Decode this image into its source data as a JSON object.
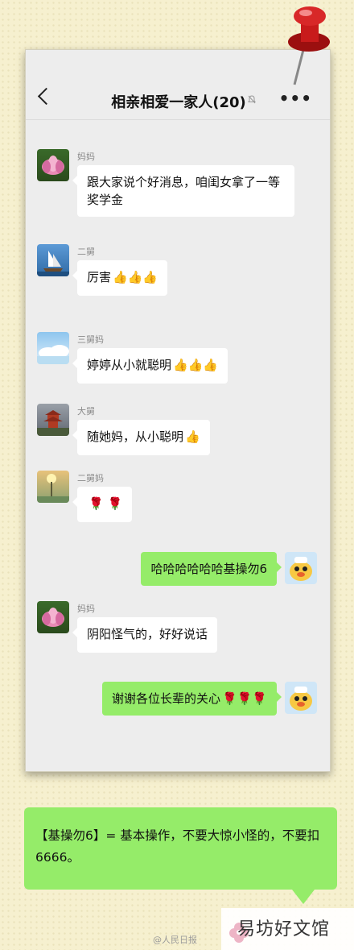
{
  "chat": {
    "title": "相亲相爱一家人(20)",
    "mute_icon": "bell-off-icon",
    "more_label": "•••"
  },
  "messages": [
    {
      "sender": "妈妈",
      "text": "跟大家说个好消息，咱闺女拿了一等奖学金",
      "emoji": ""
    },
    {
      "sender": "二舅",
      "text": "厉害",
      "emoji": "👍👍👍"
    },
    {
      "sender": "三舅妈",
      "text": "婷婷从小就聪明",
      "emoji": "👍👍👍"
    },
    {
      "sender": "大舅",
      "text": "随她妈，从小聪明",
      "emoji": "👍"
    },
    {
      "sender": "二舅妈",
      "text": "",
      "emoji": "🌹 🌹"
    },
    {
      "sender": "me",
      "text": "哈哈哈哈哈哈基操勿6",
      "emoji": ""
    },
    {
      "sender": "妈妈",
      "text": "阴阳怪气的，好好说话",
      "emoji": ""
    },
    {
      "sender": "me",
      "text": "谢谢各位长辈的关心",
      "emoji": "🌹🌹🌹"
    }
  ],
  "note": {
    "text": "【基操勿6】= 基本操作，不要大惊小怪的，不要扣6666。"
  },
  "watermark": {
    "left": "@人民日报",
    "right": "易坊好文馆"
  },
  "colors": {
    "background": "#f6f0cf",
    "my_bubble": "#95ec69",
    "other_bubble": "#ffffff",
    "chat_bg": "#ededed"
  }
}
